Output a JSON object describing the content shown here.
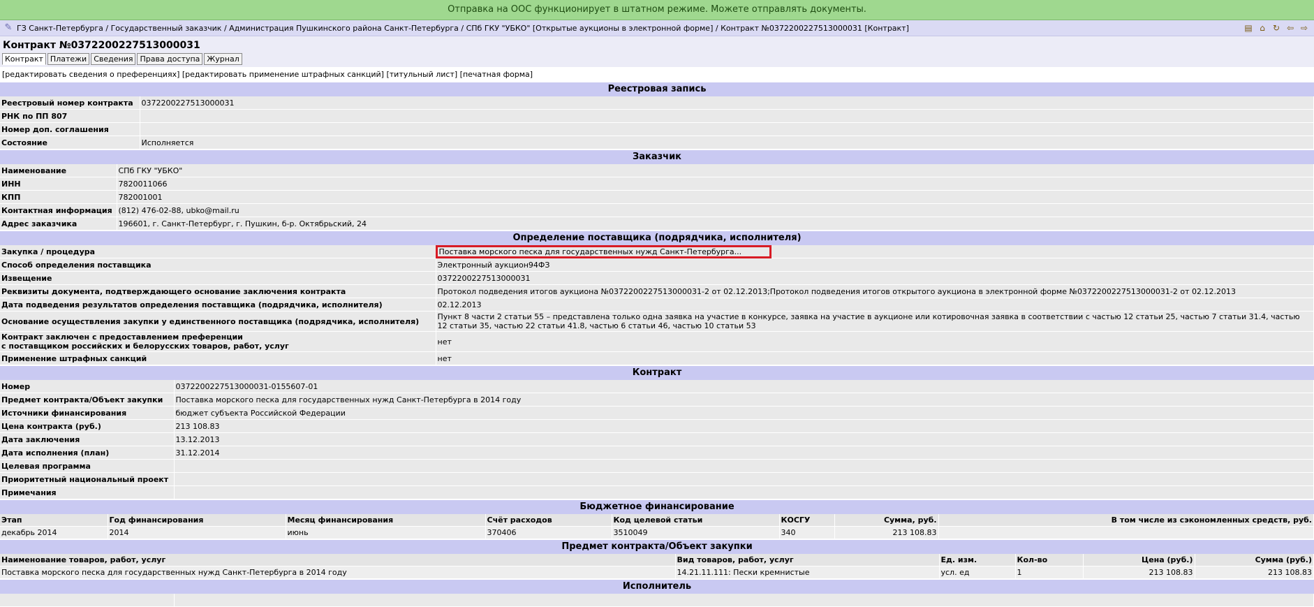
{
  "notification": "Отправка на ООС функционирует в штатном режиме. Можете отправлять документы.",
  "breadcrumb": "ГЗ Санкт-Петербурга / Государственный заказчик / Администрация Пушкинского района Санкт-Петербурга / СПб ГКУ \"УБКО\" [Открытые аукционы в электронной форме] / Контракт №0372200227513000031 [Контракт]",
  "toolbar_icons": [
    "folder-icon",
    "home-icon",
    "refresh-icon",
    "back-icon",
    "forward-icon"
  ],
  "title": "Контракт №0372200227513000031",
  "tabs": [
    "Контракт",
    "Платежи",
    "Сведения",
    "Права доступа",
    "Журнал"
  ],
  "actions": [
    "[редактировать сведения о преференциях]",
    "[редактировать применение штрафных санкций]",
    "[титульный лист]",
    "[печатная форма]"
  ],
  "registry": {
    "header": "Реестровая запись",
    "rows": [
      {
        "label": "Реестровый номер контракта",
        "value": "0372200227513000031"
      },
      {
        "label": "РНК по ПП 807",
        "value": ""
      },
      {
        "label": "Номер доп. соглашения",
        "value": ""
      },
      {
        "label": "Состояние",
        "value": "Исполняется"
      }
    ]
  },
  "customer": {
    "header": "Заказчик",
    "rows": [
      {
        "label": "Наименование",
        "value": "СПб ГКУ \"УБКО\""
      },
      {
        "label": "ИНН",
        "value": "7820011066"
      },
      {
        "label": "КПП",
        "value": "782001001"
      },
      {
        "label": "Контактная информация",
        "value": "(812) 476-02-88, ubko@mail.ru"
      },
      {
        "label": "Адрес заказчика",
        "value": "196601, г. Санкт-Петербург, г. Пушкин, б-р. Октябрьский, 24"
      }
    ]
  },
  "supplier": {
    "header": "Определение поставщика (подрядчика, исполнителя)",
    "procurement_label": "Закупка / процедура",
    "procurement_value": "Поставка морского песка для государственных нужд Санкт-Петербурга...",
    "rows": [
      {
        "label": "Способ определения поставщика",
        "value": "Электронный аукцион94ФЗ"
      },
      {
        "label": "Извещение",
        "value": "0372200227513000031"
      },
      {
        "label": "Реквизиты документа, подтверждающего основание заключения контракта",
        "value": "Протокол подведения итогов аукциона №0372200227513000031-2 от 02.12.2013;Протокол подведения итогов открытого аукциона в электронной форме №0372200227513000031-2 от 02.12.2013"
      },
      {
        "label": "Дата подведения результатов определения поставщика (подрядчика, исполнителя)",
        "value": "02.12.2013"
      },
      {
        "label": "Основание осуществления закупки у единственного поставщика (подрядчика, исполнителя)",
        "value": "Пункт 8 части 2 статьи 55 – представлена только одна заявка на участие в конкурсе, заявка на участие в аукционе или котировочная заявка в соответствии с частью 12 статьи 25, частью 7 статьи 31.4, частью 12 статьи 35, частью 22 статьи 41.8, частью 6 статьи 46, частью 10 статьи 53"
      },
      {
        "label": "Контракт заключен с предоставлением преференции\nс поставщиком российских и белорусских товаров, работ, услуг",
        "value": "нет"
      },
      {
        "label": "Применение штрафных санкций",
        "value": "нет"
      }
    ]
  },
  "contract": {
    "header": "Контракт",
    "rows": [
      {
        "label": "Номер",
        "value": "0372200227513000031-0155607-01"
      },
      {
        "label": "Предмет контракта/Объект закупки",
        "value": "Поставка морского песка для государственных нужд Санкт-Петербурга в 2014 году"
      },
      {
        "label": "Источники финансирования",
        "value": "бюджет субъекта Российской Федерации"
      },
      {
        "label": "Цена контракта (руб.)",
        "value": "213 108.83"
      },
      {
        "label": "Дата заключения",
        "value": "13.12.2013"
      },
      {
        "label": "Дата исполнения (план)",
        "value": "31.12.2014"
      },
      {
        "label": "Целевая программа",
        "value": ""
      },
      {
        "label": "Приоритетный национальный проект",
        "value": ""
      },
      {
        "label": "Примечания",
        "value": ""
      }
    ]
  },
  "budget": {
    "header": "Бюджетное финансирование",
    "columns": [
      "Этап",
      "Год финансирования",
      "Месяц финансирования",
      "Счёт расходов",
      "Код целевой статьи",
      "КОСГУ",
      "Сумма, руб.",
      "В том числе из сэкономленных средств, руб."
    ],
    "rows": [
      [
        "декабрь 2014",
        "2014",
        "июнь",
        "370406",
        "3510049",
        "340",
        "213 108.83",
        ""
      ]
    ]
  },
  "subject": {
    "header": "Предмет контракта/Объект закупки",
    "columns": [
      "Наименование товаров, работ, услуг",
      "Вид товаров, работ, услуг",
      "Ед. изм.",
      "Кол-во",
      "Цена (руб.)",
      "Сумма (руб.)"
    ],
    "rows": [
      [
        "Поставка морского песка для государственных нужд Санкт-Петербурга в 2014 году",
        "14.21.11.111: Пески кремнистые",
        "усл. ед",
        "1",
        "213 108.83",
        "213 108.83"
      ]
    ]
  },
  "executor": {
    "header": "Исполнитель"
  }
}
